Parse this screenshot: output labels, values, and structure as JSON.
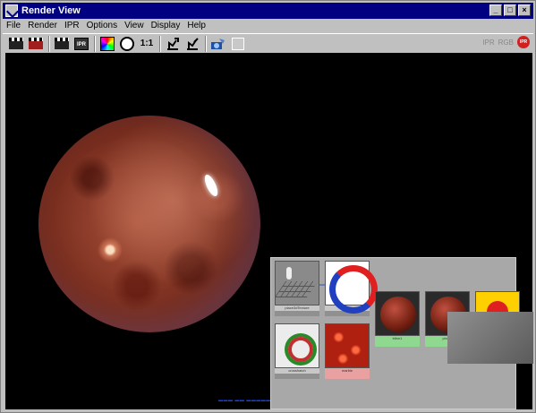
{
  "window": {
    "title": "Render View",
    "minimize": "_",
    "maximize": "□",
    "close": "×"
  },
  "menu": [
    "File",
    "Render",
    "IPR",
    "Options",
    "View",
    "Display",
    "Help"
  ],
  "toolbar": {
    "ratio_label": "1:1",
    "ipr_box": "IPR",
    "right_ipr": "IPR",
    "right_rgb": "RGB",
    "right_red": "IPR"
  },
  "hypershade": {
    "nodes": [
      {
        "name": "node-place3dTexture",
        "label": "place3dTexture"
      },
      {
        "name": "node-swirl",
        "label": "swirl"
      },
      {
        "name": "node-blinn1",
        "label": "blinn1"
      },
      {
        "name": "node-phong",
        "label": "phong"
      },
      {
        "name": "node-shader",
        "label": ""
      },
      {
        "name": "node-crosshatch",
        "label": "crosshatch"
      },
      {
        "name": "node-lava",
        "label": "marble"
      }
    ]
  }
}
